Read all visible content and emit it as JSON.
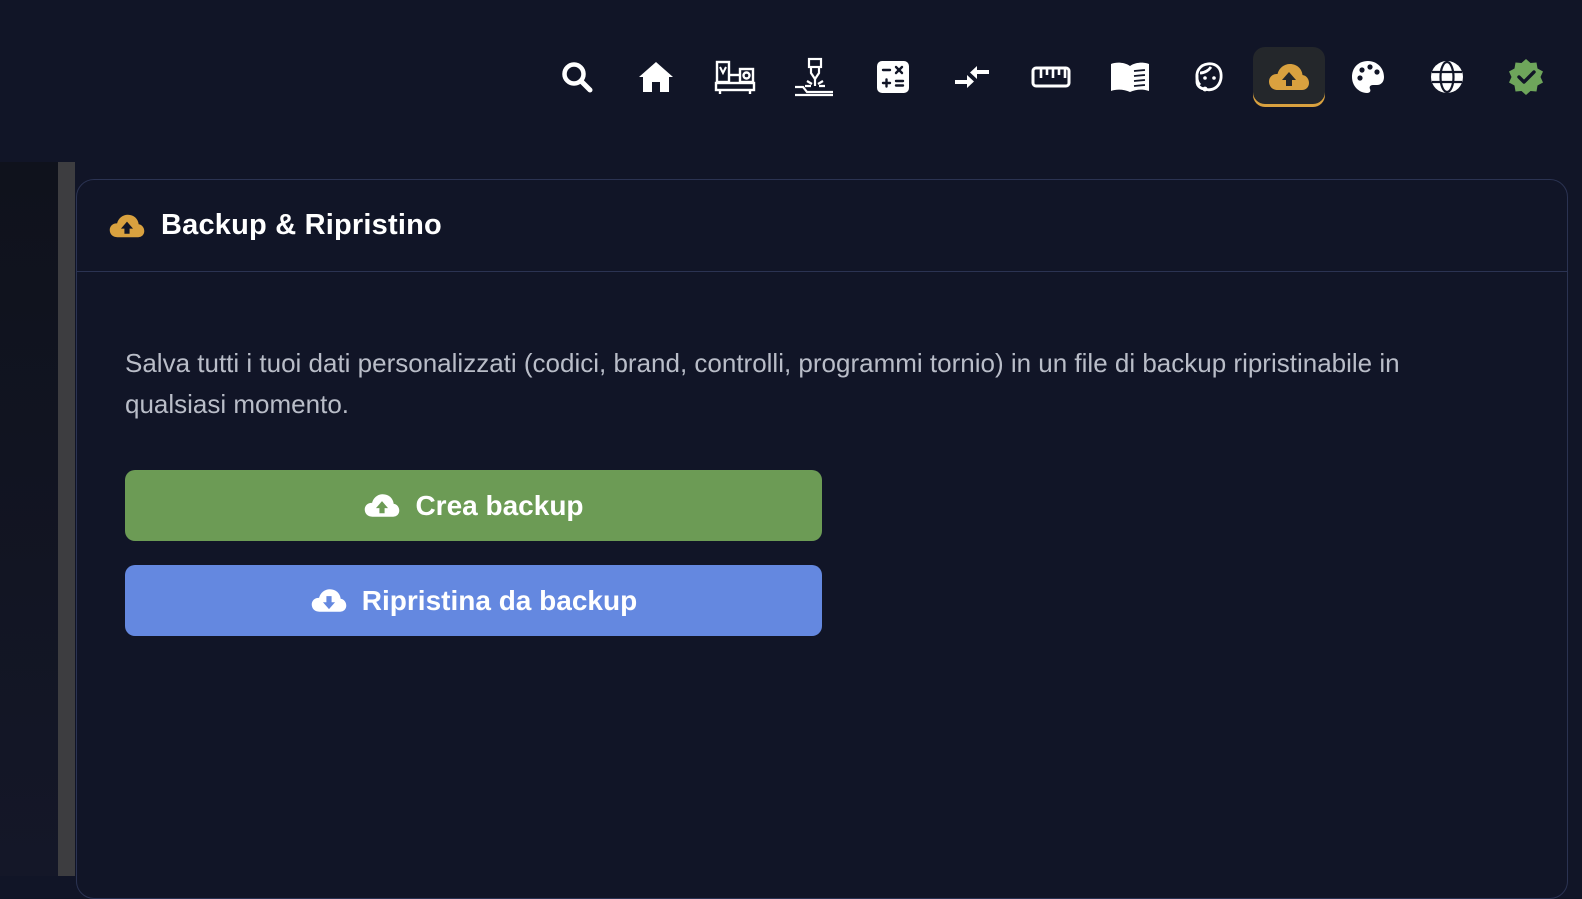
{
  "nav": {
    "items": [
      {
        "name": "search-icon",
        "label": "Cerca"
      },
      {
        "name": "home-icon",
        "label": "Home"
      },
      {
        "name": "lathe-icon",
        "label": "Tornio"
      },
      {
        "name": "laser-cutter-icon",
        "label": "Laser"
      },
      {
        "name": "calculator-icon",
        "label": "Calcolatrice"
      },
      {
        "name": "compare-icon",
        "label": "Confronta"
      },
      {
        "name": "ruler-icon",
        "label": "Misure"
      },
      {
        "name": "book-icon",
        "label": "Manuale"
      },
      {
        "name": "support-agent-icon",
        "label": "Supporto"
      },
      {
        "name": "cloud-upload-icon",
        "label": "Backup"
      },
      {
        "name": "palette-icon",
        "label": "Tema"
      },
      {
        "name": "globe-icon",
        "label": "Lingua"
      },
      {
        "name": "verified-badge-icon",
        "label": "Verificato"
      }
    ],
    "active_index": 9
  },
  "card": {
    "title": "Backup & Ripristino",
    "description": "Salva tutti i tuoi dati personalizzati (codici, brand, controlli, programmi tornio) in un file di backup ripristinabile in qualsiasi momento."
  },
  "actions": {
    "create_label": "Crea backup",
    "restore_label": "Ripristina da backup"
  },
  "colors": {
    "background": "#111527",
    "accent_gold": "#d9a13f",
    "create_button": "#6c9b55",
    "restore_button": "#6488e0",
    "verified_badge": "#6ea55b"
  }
}
